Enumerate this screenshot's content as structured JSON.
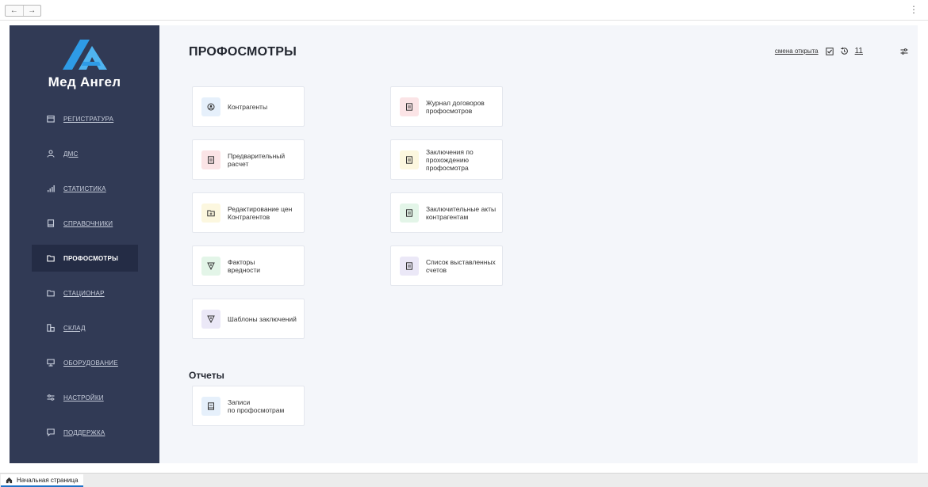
{
  "nav_back": "←",
  "nav_forward": "→",
  "menu_glyph": "⋮",
  "sidebar": {
    "brand": "Мед Ангел",
    "items": [
      {
        "label": "РЕГИСТРАТУРА",
        "icon": "calendar-icon"
      },
      {
        "label": "ДМС",
        "icon": "user-icon"
      },
      {
        "label": "СТАТИСТИКА",
        "icon": "bar-chart-icon"
      },
      {
        "label": "СПРАВОЧНИКИ",
        "icon": "book-icon"
      },
      {
        "label": "ПРОФОСМОТРЫ",
        "icon": "folder-icon",
        "active": true
      },
      {
        "label": "СТАЦИОНАР",
        "icon": "folder-icon"
      },
      {
        "label": "СКЛАД",
        "icon": "warehouse-icon"
      },
      {
        "label": "ОБОРУДОВАНИЕ",
        "icon": "monitor-icon"
      },
      {
        "label": "НАСТРОЙКИ",
        "icon": "sliders-icon"
      },
      {
        "label": "ПОДДЕРЖКА",
        "icon": "chat-icon"
      }
    ]
  },
  "header": {
    "title": "ПРОФОСМОТРЫ",
    "shift_link": "смена открыта",
    "history_count": "11"
  },
  "cards": {
    "kontragenty": "Контрагенты",
    "prelim": "Предварительный\nрасчет",
    "edit_prices": "Редактирование цен\nКонтрагентов",
    "factors": "Факторы\nвредности",
    "templates": "Шаблоны заключений",
    "journal": "Журнал договоров\nпрофосмотров",
    "conclusions": "Заключения по\nпрохождению\nпрофосмотра",
    "final_acts": "Заключительные акты\nконтрагентам",
    "invoices": "Список выставленных\nсчетов"
  },
  "reports": {
    "title": "Отчеты",
    "records": "Записи\nпо профосмотрам"
  },
  "taskbar": {
    "tab_label": "Начальная страница"
  },
  "colors": {
    "sidebar_bg": "#313a55",
    "sidebar_active": "#242c45",
    "main_bg": "#f4f6fa",
    "logo_blue": "#2e9be6"
  }
}
